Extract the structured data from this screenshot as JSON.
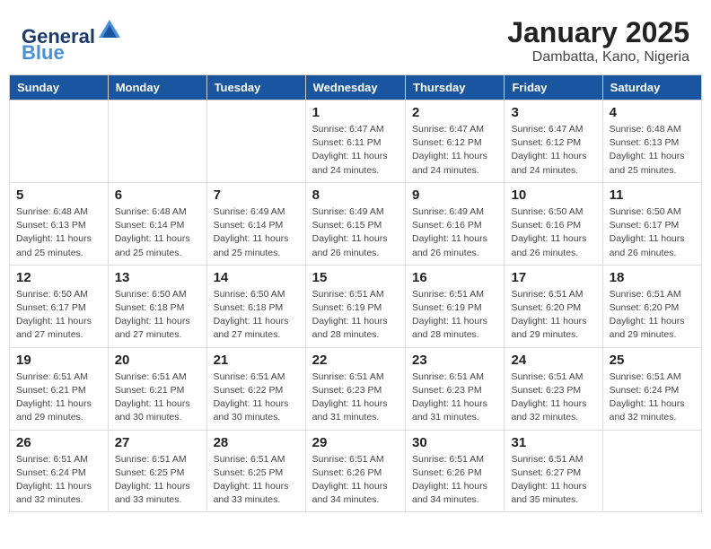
{
  "header": {
    "logo_line1": "General",
    "logo_line2": "Blue",
    "month_title": "January 2025",
    "location": "Dambatta, Kano, Nigeria"
  },
  "days_of_week": [
    "Sunday",
    "Monday",
    "Tuesday",
    "Wednesday",
    "Thursday",
    "Friday",
    "Saturday"
  ],
  "weeks": [
    [
      {
        "day": "",
        "info": ""
      },
      {
        "day": "",
        "info": ""
      },
      {
        "day": "",
        "info": ""
      },
      {
        "day": "1",
        "info": "Sunrise: 6:47 AM\nSunset: 6:11 PM\nDaylight: 11 hours\nand 24 minutes."
      },
      {
        "day": "2",
        "info": "Sunrise: 6:47 AM\nSunset: 6:12 PM\nDaylight: 11 hours\nand 24 minutes."
      },
      {
        "day": "3",
        "info": "Sunrise: 6:47 AM\nSunset: 6:12 PM\nDaylight: 11 hours\nand 24 minutes."
      },
      {
        "day": "4",
        "info": "Sunrise: 6:48 AM\nSunset: 6:13 PM\nDaylight: 11 hours\nand 25 minutes."
      }
    ],
    [
      {
        "day": "5",
        "info": "Sunrise: 6:48 AM\nSunset: 6:13 PM\nDaylight: 11 hours\nand 25 minutes."
      },
      {
        "day": "6",
        "info": "Sunrise: 6:48 AM\nSunset: 6:14 PM\nDaylight: 11 hours\nand 25 minutes."
      },
      {
        "day": "7",
        "info": "Sunrise: 6:49 AM\nSunset: 6:14 PM\nDaylight: 11 hours\nand 25 minutes."
      },
      {
        "day": "8",
        "info": "Sunrise: 6:49 AM\nSunset: 6:15 PM\nDaylight: 11 hours\nand 26 minutes."
      },
      {
        "day": "9",
        "info": "Sunrise: 6:49 AM\nSunset: 6:16 PM\nDaylight: 11 hours\nand 26 minutes."
      },
      {
        "day": "10",
        "info": "Sunrise: 6:50 AM\nSunset: 6:16 PM\nDaylight: 11 hours\nand 26 minutes."
      },
      {
        "day": "11",
        "info": "Sunrise: 6:50 AM\nSunset: 6:17 PM\nDaylight: 11 hours\nand 26 minutes."
      }
    ],
    [
      {
        "day": "12",
        "info": "Sunrise: 6:50 AM\nSunset: 6:17 PM\nDaylight: 11 hours\nand 27 minutes."
      },
      {
        "day": "13",
        "info": "Sunrise: 6:50 AM\nSunset: 6:18 PM\nDaylight: 11 hours\nand 27 minutes."
      },
      {
        "day": "14",
        "info": "Sunrise: 6:50 AM\nSunset: 6:18 PM\nDaylight: 11 hours\nand 27 minutes."
      },
      {
        "day": "15",
        "info": "Sunrise: 6:51 AM\nSunset: 6:19 PM\nDaylight: 11 hours\nand 28 minutes."
      },
      {
        "day": "16",
        "info": "Sunrise: 6:51 AM\nSunset: 6:19 PM\nDaylight: 11 hours\nand 28 minutes."
      },
      {
        "day": "17",
        "info": "Sunrise: 6:51 AM\nSunset: 6:20 PM\nDaylight: 11 hours\nand 29 minutes."
      },
      {
        "day": "18",
        "info": "Sunrise: 6:51 AM\nSunset: 6:20 PM\nDaylight: 11 hours\nand 29 minutes."
      }
    ],
    [
      {
        "day": "19",
        "info": "Sunrise: 6:51 AM\nSunset: 6:21 PM\nDaylight: 11 hours\nand 29 minutes."
      },
      {
        "day": "20",
        "info": "Sunrise: 6:51 AM\nSunset: 6:21 PM\nDaylight: 11 hours\nand 30 minutes."
      },
      {
        "day": "21",
        "info": "Sunrise: 6:51 AM\nSunset: 6:22 PM\nDaylight: 11 hours\nand 30 minutes."
      },
      {
        "day": "22",
        "info": "Sunrise: 6:51 AM\nSunset: 6:23 PM\nDaylight: 11 hours\nand 31 minutes."
      },
      {
        "day": "23",
        "info": "Sunrise: 6:51 AM\nSunset: 6:23 PM\nDaylight: 11 hours\nand 31 minutes."
      },
      {
        "day": "24",
        "info": "Sunrise: 6:51 AM\nSunset: 6:23 PM\nDaylight: 11 hours\nand 32 minutes."
      },
      {
        "day": "25",
        "info": "Sunrise: 6:51 AM\nSunset: 6:24 PM\nDaylight: 11 hours\nand 32 minutes."
      }
    ],
    [
      {
        "day": "26",
        "info": "Sunrise: 6:51 AM\nSunset: 6:24 PM\nDaylight: 11 hours\nand 32 minutes."
      },
      {
        "day": "27",
        "info": "Sunrise: 6:51 AM\nSunset: 6:25 PM\nDaylight: 11 hours\nand 33 minutes."
      },
      {
        "day": "28",
        "info": "Sunrise: 6:51 AM\nSunset: 6:25 PM\nDaylight: 11 hours\nand 33 minutes."
      },
      {
        "day": "29",
        "info": "Sunrise: 6:51 AM\nSunset: 6:26 PM\nDaylight: 11 hours\nand 34 minutes."
      },
      {
        "day": "30",
        "info": "Sunrise: 6:51 AM\nSunset: 6:26 PM\nDaylight: 11 hours\nand 34 minutes."
      },
      {
        "day": "31",
        "info": "Sunrise: 6:51 AM\nSunset: 6:27 PM\nDaylight: 11 hours\nand 35 minutes."
      },
      {
        "day": "",
        "info": ""
      }
    ]
  ]
}
